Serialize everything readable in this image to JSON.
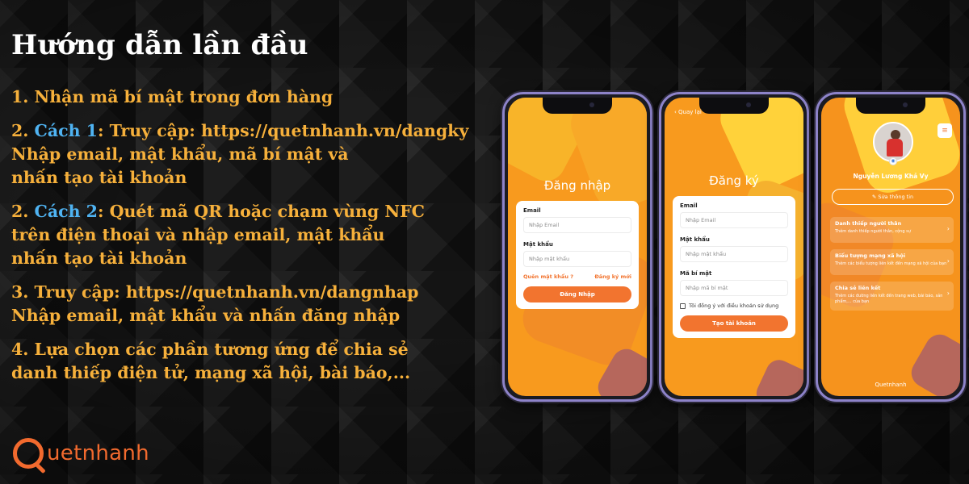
{
  "title": "Hướng dẫn lần đầu",
  "steps": [
    {
      "lines": [
        {
          "parts": [
            {
              "text": "1. Nhận mã bí mật trong đơn hàng"
            }
          ]
        }
      ]
    },
    {
      "lines": [
        {
          "parts": [
            {
              "text": "2. "
            },
            {
              "text": "Cách 1",
              "hl": true
            },
            {
              "text": ": Truy cập: https://quetnhanh.vn/dangky"
            }
          ]
        },
        {
          "parts": [
            {
              "text": "Nhập email, mật khẩu, mã bí mật và"
            }
          ]
        },
        {
          "parts": [
            {
              "text": "nhấn tạo tài khoản"
            }
          ]
        }
      ]
    },
    {
      "lines": [
        {
          "parts": [
            {
              "text": "2. "
            },
            {
              "text": "Cách 2",
              "hl": true
            },
            {
              "text": ": Quét mã QR hoặc chạm vùng NFC"
            }
          ]
        },
        {
          "parts": [
            {
              "text": "trên điện thoại và nhập email, mật khẩu"
            }
          ]
        },
        {
          "parts": [
            {
              "text": "nhấn tạo tài khoản"
            }
          ]
        }
      ]
    },
    {
      "lines": [
        {
          "parts": [
            {
              "text": "3. Truy cập: https://quetnhanh.vn/dangnhap"
            }
          ]
        },
        {
          "parts": [
            {
              "text": "Nhập email, mật khẩu và nhấn đăng nhập"
            }
          ]
        }
      ]
    },
    {
      "lines": [
        {
          "parts": [
            {
              "text": "4. Lựa chọn các phần tương ứng để chia sẻ"
            }
          ]
        },
        {
          "parts": [
            {
              "text": "danh thiếp điện tử, mạng xã hội, bài báo,..."
            }
          ]
        }
      ]
    }
  ],
  "logo": {
    "text": "uetnhanh"
  },
  "login_screen": {
    "title": "Đăng nhập",
    "email_label": "Email",
    "email_placeholder": "Nhập Email",
    "password_label": "Mật khẩu",
    "password_placeholder": "Nhập mật khẩu",
    "forgot_link": "Quên mật khẩu ?",
    "register_link": "Đăng ký mới",
    "submit": "Đăng Nhập"
  },
  "register_screen": {
    "back": "Quay lại",
    "title": "Đăng ký",
    "email_label": "Email",
    "email_placeholder": "Nhập Email",
    "password_label": "Mật khẩu",
    "password_placeholder": "Nhập mật khẩu",
    "secret_label": "Mã bí mật",
    "secret_placeholder": "Nhập mã bí mật",
    "terms": "Tôi đồng ý với điều khoản sử dụng",
    "submit": "Tạo tài khoản"
  },
  "profile_screen": {
    "name": "Nguyễn Lương Khả Vy",
    "edit": "✎ Sửa thông tin",
    "sections": [
      {
        "title": "Danh thiếp người thân",
        "desc": "Thêm danh thiếp người thân, cộng sự"
      },
      {
        "title": "Biểu tượng mạng xã hội",
        "desc": "Thêm các biểu tượng liên kết đến mạng xã hội của bạn"
      },
      {
        "title": "Chia sẻ liên kết",
        "desc": "Thêm các đường liên kết đến trang web, bài báo, sản phẩm,... của bạn"
      }
    ],
    "brand": "Quetnhanh"
  },
  "colors": {
    "accent": "#f6b03b",
    "highlight": "#4fb3f2",
    "brand": "#f26a2e",
    "screen_bg": "#f89a1e"
  }
}
